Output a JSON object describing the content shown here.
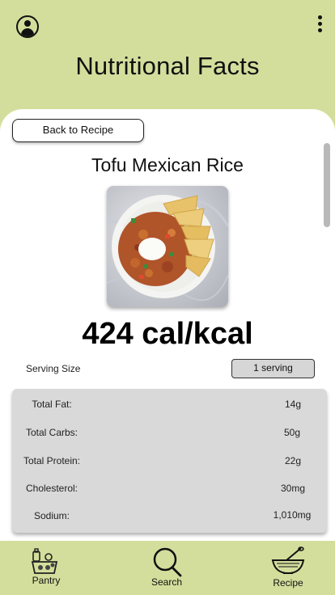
{
  "header": {
    "title": "Nutritional Facts",
    "profile_icon": "user-circle-icon",
    "menu_icon": "kebab-menu-icon"
  },
  "back_button": {
    "label": "Back to Recipe"
  },
  "recipe": {
    "name": "Tofu Mexican Rice",
    "calories": "424 cal/kcal"
  },
  "serving": {
    "label": "Serving Size",
    "selected": "1 serving"
  },
  "nutrition": [
    {
      "label": "Total Fat:",
      "value": "14g"
    },
    {
      "label": "Total Carbs:",
      "value": "50g"
    },
    {
      "label": "Total Protein:",
      "value": "22g"
    },
    {
      "label": "Cholesterol:",
      "value": "30mg"
    },
    {
      "label": "Sodium:",
      "value": "1,010mg"
    }
  ],
  "nav": [
    {
      "label": "Pantry",
      "icon": "pantry-groceries-icon"
    },
    {
      "label": "Search",
      "icon": "search-icon"
    },
    {
      "label": "Recipe",
      "icon": "mixing-bowl-icon"
    }
  ],
  "colors": {
    "header_background": "#d3de9c",
    "panel_background": "#ffffff",
    "table_background": "#d9d9d9"
  }
}
